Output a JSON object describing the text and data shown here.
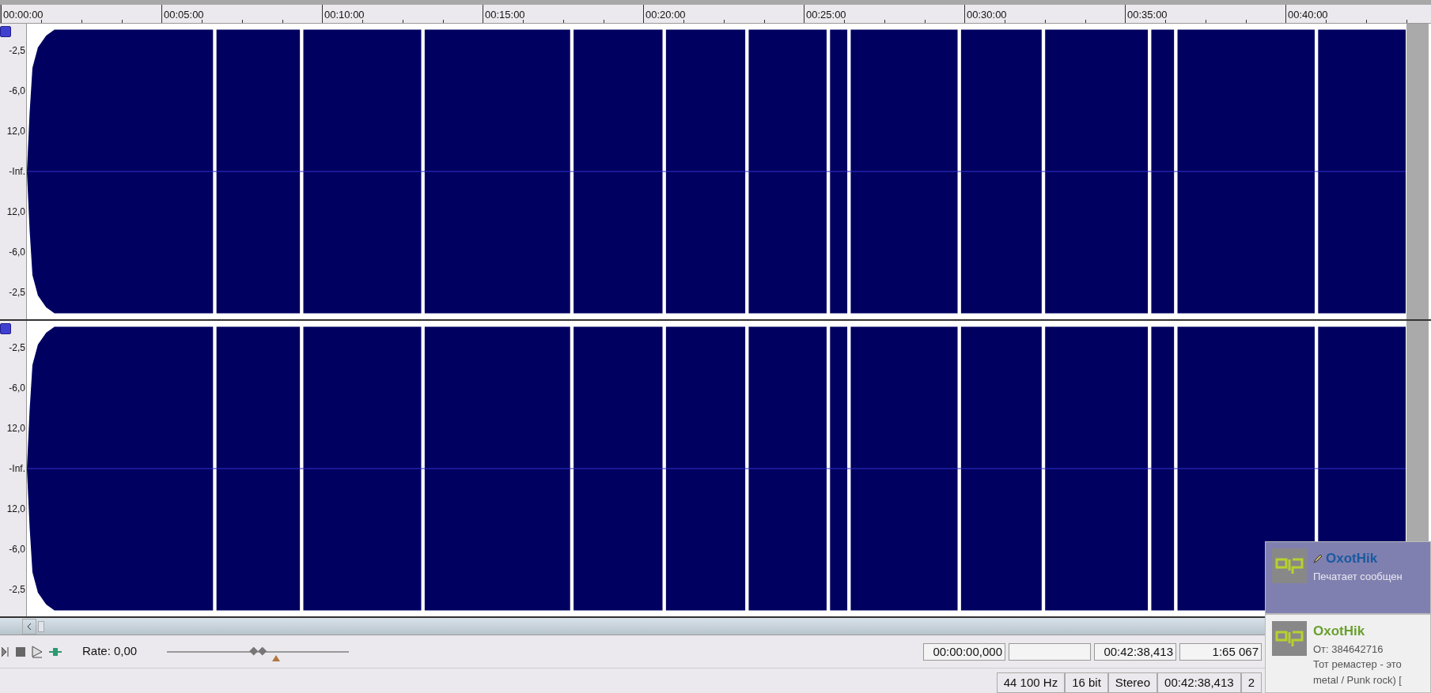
{
  "ruler": {
    "labels": [
      "00:00:00",
      "00:05:00",
      "00:10:00",
      "00:15:00",
      "00:20:00",
      "00:25:00",
      "00:30:00",
      "00:35:00",
      "00:40:00"
    ]
  },
  "channels": [
    {
      "scale": [
        "-2,5",
        "-6,0",
        "12,0",
        "-Inf.",
        "12,0",
        "-6,0",
        "-2,5"
      ]
    },
    {
      "scale": [
        "-2,5",
        "-6,0",
        "12,0",
        "-Inf.",
        "12,0",
        "-6,0",
        "-2,5"
      ]
    }
  ],
  "transport": {
    "rate": "Rate: 0,00",
    "slider": {
      "level": 0.5
    }
  },
  "time_fields": [
    "00:00:00,000",
    "00:42:38,413",
    "1:65 067"
  ],
  "status_bar": [
    "44 100 Hz",
    "16 bit",
    "Stereo",
    "00:42:38,413",
    "2"
  ],
  "notifications": [
    {
      "name": "OxotHik",
      "lines": [
        "Печатает сообщен"
      ]
    },
    {
      "name": "OxotHik",
      "lines": [
        "От: 384642716",
        "Тот ремастер - это",
        "metal / Punk rock) ["
      ]
    }
  ]
}
